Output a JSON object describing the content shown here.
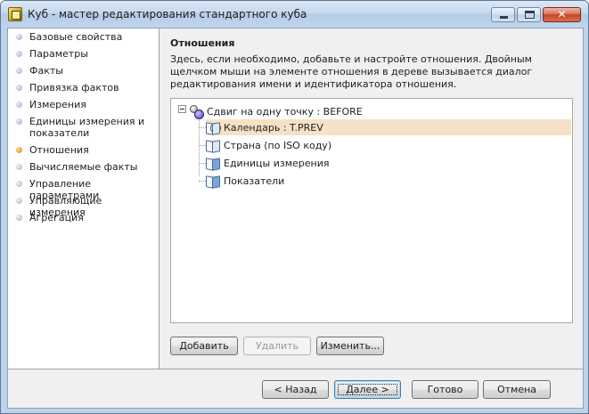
{
  "window": {
    "title": "Куб - мастер редактирования стандартного куба",
    "close_glyph": "✕"
  },
  "nav": {
    "items": [
      {
        "label": "Базовые свойства",
        "state": "normal"
      },
      {
        "label": "Параметры",
        "state": "normal"
      },
      {
        "label": "Факты",
        "state": "normal"
      },
      {
        "label": "Привязка фактов",
        "state": "normal"
      },
      {
        "label": "Измерения",
        "state": "normal"
      },
      {
        "label": "Единицы измерения и показатели",
        "state": "normal"
      },
      {
        "label": "Отношения",
        "state": "active"
      },
      {
        "label": "Вычисляемые факты",
        "state": "disabled"
      },
      {
        "label": "Управление параметрами",
        "state": "disabled"
      },
      {
        "label": "Управляющие измерения",
        "state": "disabled"
      },
      {
        "label": "Агрегация",
        "state": "disabled"
      }
    ]
  },
  "main": {
    "heading": "Отношения",
    "description": "Здесь, если необходимо, добавьте и настройте отношения. Двойным щелчком мыши на элементе отношения в дереве вызывается диалог редактирования имени и идентификатора отношения.",
    "tree": {
      "root": {
        "label": "Сдвиг на одну точку : BEFORE",
        "icon": "relation-icon"
      },
      "children": [
        {
          "label": "Календарь : T.PREV",
          "icon": "calendar-dimension-icon",
          "selected": true
        },
        {
          "label": "Страна (по ISO коду)",
          "icon": "dictionary-icon",
          "selected": false
        },
        {
          "label": "Единицы измерения",
          "icon": "dimension-icon",
          "selected": false
        },
        {
          "label": "Показатели",
          "icon": "dimension-icon",
          "selected": false
        }
      ]
    },
    "buttons": {
      "add": "Добавить",
      "delete": "Удалить",
      "edit": "Изменить..."
    }
  },
  "footer": {
    "back": "< Назад",
    "next": "Далее >",
    "finish": "Готово",
    "cancel": "Отмена"
  },
  "colors": {
    "active_step": "#e8861a",
    "selection": "#f5e2c6"
  }
}
